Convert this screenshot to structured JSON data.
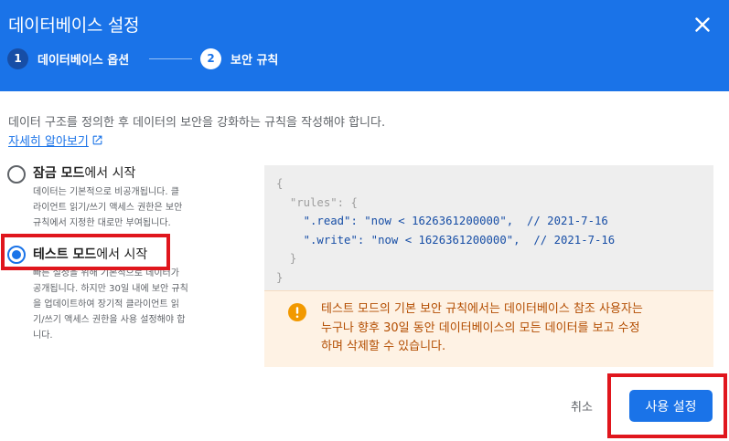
{
  "dialog": {
    "title": "데이터베이스 설정",
    "close_icon": "close-icon"
  },
  "steps": [
    {
      "number": "1",
      "label": "데이터베이스 옵션",
      "state": "completed"
    },
    {
      "number": "2",
      "label": "보안 규칙",
      "state": "active"
    }
  ],
  "description": "데이터 구조를 정의한 후 데이터의 보안을 강화하는 규칙을 작성해야 합니다.",
  "learn_more": {
    "label": "자세히 알아보기",
    "icon": "open-in-new-icon"
  },
  "options": [
    {
      "title_bold": "잠금 모드",
      "title_rest": "에서 시작",
      "desc_lines": [
        "데이터는 기본적으로 비공개됩니다. 클",
        "라이언트 읽기/쓰기 액세스 권한은 보안",
        "규칙에서 지정한 대로만 부여됩니다."
      ],
      "selected": false
    },
    {
      "title_bold": "테스트 모드",
      "title_rest": "에서 시작",
      "desc_lines": [
        "빠른 설정을 위해 기본적으로 데이터가",
        "공개됩니다. 하지만 30일 내에 보안 규칙",
        "을 업데이트하여 장기적 클라이언트 읽",
        "기/쓰기 액세스 권한을 사용 설정해야 합",
        "니다."
      ],
      "selected": true
    }
  ],
  "code": {
    "open_brace": "{",
    "rules_key": "\"rules\"",
    "rules_open": ": {",
    "read_key": "\".read\"",
    "read_value": "\"now < 1626361200000\"",
    "read_comment": ",  // 2021-7-16",
    "write_key": "\".write\"",
    "write_value": "\"now < 1626361200000\"",
    "write_comment": ",  // 2021-7-16",
    "rules_close": "}",
    "close_brace": "}"
  },
  "warning": {
    "icon": "warning-exclamation-icon",
    "lines": [
      "테스트 모드의 기본 보안 규칙에서는 데이터베이스 참조 사용자는",
      "누구나 향후 30일 동안 데이터베이스의 모든 데이터를 보고 수정",
      "하며 삭제할 수 있습니다."
    ]
  },
  "footer": {
    "cancel_label": "취소",
    "primary_label": "사용 설정"
  },
  "colors": {
    "header_blue": "#1a73e8",
    "highlight_red": "#e0161d",
    "warning_bg": "#fef2e4",
    "warning_text": "#b34d00",
    "warning_icon": "#f29900"
  }
}
